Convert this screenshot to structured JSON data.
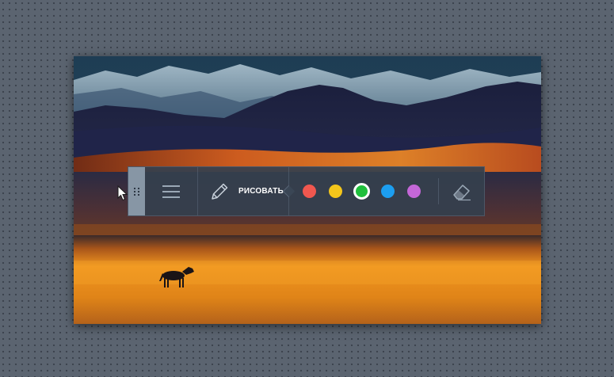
{
  "toolbar": {
    "draw_label": "РИСОВАТЬ",
    "colors": [
      {
        "name": "red",
        "hex": "#f0574f",
        "selected": false
      },
      {
        "name": "yellow",
        "hex": "#f4c61b",
        "selected": false
      },
      {
        "name": "green",
        "hex": "#1fbf3c",
        "selected": true
      },
      {
        "name": "blue",
        "hex": "#1c9ef0",
        "selected": false
      },
      {
        "name": "purple",
        "hex": "#c467d8",
        "selected": false
      }
    ],
    "icons": {
      "grip": "drag-handle-icon",
      "menu": "hamburger-menu-icon",
      "draw": "pencil-icon",
      "eraser": "eraser-icon"
    }
  }
}
